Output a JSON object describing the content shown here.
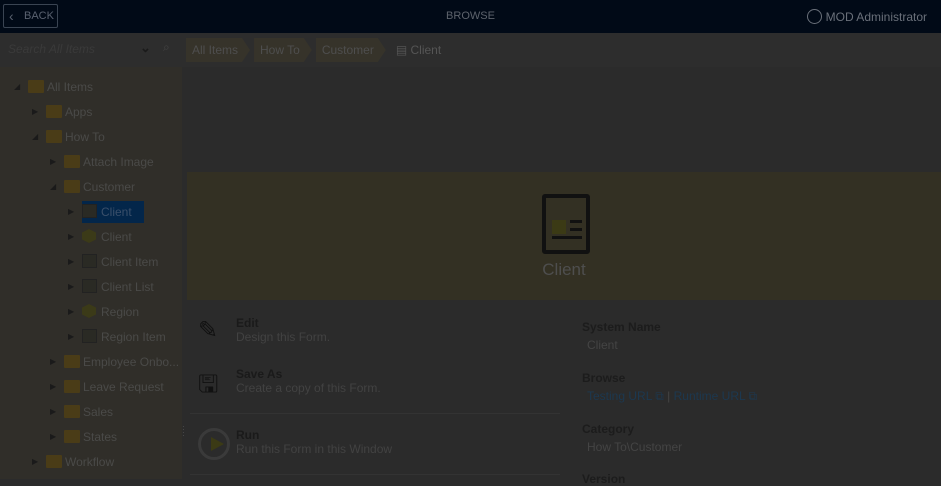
{
  "header": {
    "back_label": "BACK",
    "title": "BROWSE",
    "user": "MOD Administrator"
  },
  "search": {
    "placeholder": "Search All Items"
  },
  "breadcrumb": [
    "All Items",
    "How To",
    "Customer"
  ],
  "breadcrumb_current": "Client",
  "tree": [
    {
      "label": "All Items",
      "level": 0,
      "icon": "folder-home",
      "expanded": true
    },
    {
      "label": "Apps",
      "level": 1,
      "icon": "folder"
    },
    {
      "label": "How To",
      "level": 1,
      "icon": "folder",
      "expanded": true
    },
    {
      "label": "Attach Image",
      "level": 2,
      "icon": "folder"
    },
    {
      "label": "Customer",
      "level": 2,
      "icon": "folder",
      "expanded": true
    },
    {
      "label": "Client",
      "level": 3,
      "icon": "form",
      "selected": true
    },
    {
      "label": "Client",
      "level": 3,
      "icon": "smartobject"
    },
    {
      "label": "Client Item",
      "level": 3,
      "icon": "view"
    },
    {
      "label": "Client List",
      "level": 3,
      "icon": "view"
    },
    {
      "label": "Region",
      "level": 3,
      "icon": "smartobject"
    },
    {
      "label": "Region Item",
      "level": 3,
      "icon": "view"
    },
    {
      "label": "Employee Onbo...",
      "level": 2,
      "icon": "folder"
    },
    {
      "label": "Leave Request",
      "level": 2,
      "icon": "folder"
    },
    {
      "label": "Sales",
      "level": 2,
      "icon": "folder"
    },
    {
      "label": "States",
      "level": 2,
      "icon": "folder"
    },
    {
      "label": "Workflow",
      "level": 1,
      "icon": "folder"
    }
  ],
  "item": {
    "name": "Client"
  },
  "actions": [
    {
      "title": "Edit",
      "desc": "Design this Form."
    },
    {
      "title": "Save As",
      "desc": "Create a copy of this Form."
    },
    {
      "title": "Run",
      "desc": "Run this Form in this Window"
    }
  ],
  "properties": {
    "system_name_label": "System Name",
    "system_name": "Client",
    "browse_label": "Browse",
    "testing_url": "Testing URL",
    "runtime_url": "Runtime URL",
    "sep": "|",
    "category_label": "Category",
    "category": "How To\\Customer",
    "version_label": "Version"
  }
}
